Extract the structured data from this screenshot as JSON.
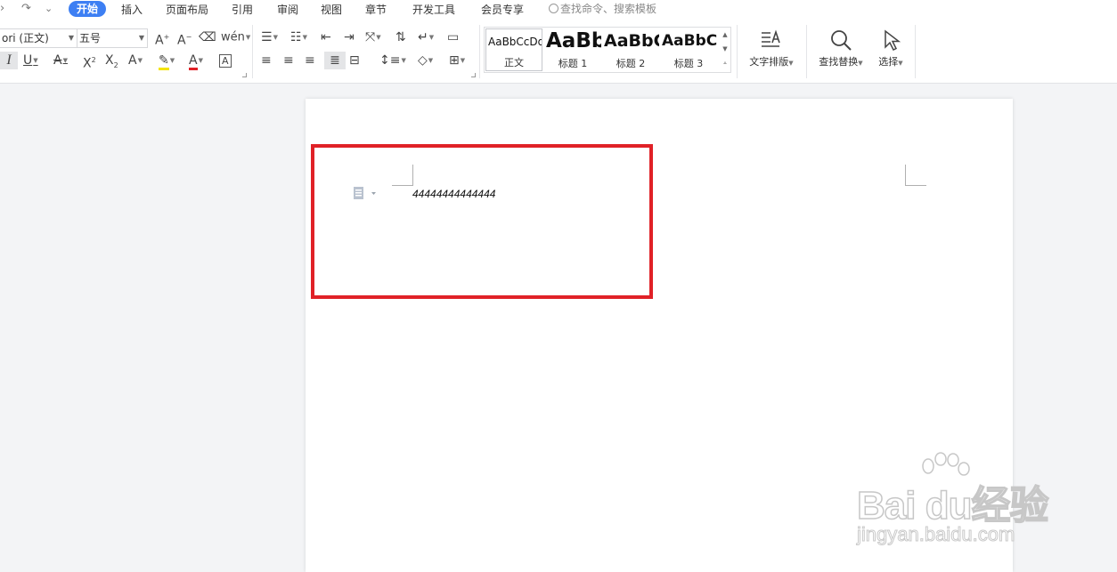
{
  "quick_access": {
    "undo_fragment": "›",
    "redo_icon": "↷",
    "more_icon": "⌄"
  },
  "tabs": [
    "开始",
    "插入",
    "页面布局",
    "引用",
    "审阅",
    "视图",
    "章节",
    "开发工具",
    "会员专享"
  ],
  "command_search": {
    "placeholder": "查找命令、搜索模板"
  },
  "ribbon": {
    "font_name": "ori (正文)",
    "font_size": "五号",
    "styles": [
      {
        "sample": "AaBbCcDd",
        "name": "正文"
      },
      {
        "sample": "AaBb",
        "name": "标题 1"
      },
      {
        "sample": "AaBbC",
        "name": "标题 2"
      },
      {
        "sample": "AaBbCc",
        "name": "标题 3"
      }
    ],
    "text_layout_label": "文字排版",
    "find_replace_label": "查找替换",
    "select_label": "选择",
    "accent_color": "#3d7ff3"
  },
  "document": {
    "body_text": "44444444444444",
    "highlight_color": "#e02127"
  },
  "watermark": {
    "brand": "Bai du经验",
    "url": "jingyan.baidu.com"
  }
}
